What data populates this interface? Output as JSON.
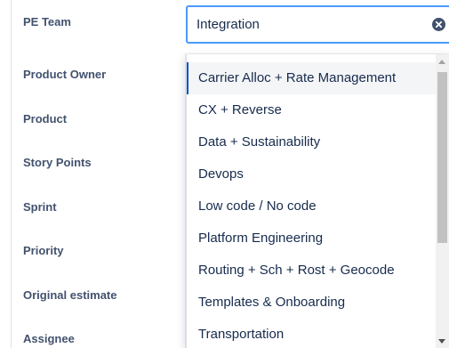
{
  "form": {
    "labels": [
      "PE Team",
      "Product Owner",
      "Product",
      "Story Points",
      "Sprint",
      "Priority",
      "Original estimate",
      "Assignee"
    ]
  },
  "pe_team_select": {
    "value": "Integration",
    "clear_icon": "clear-circle-x-icon",
    "options": [
      "Carrier Alloc + Rate Management",
      "CX + Reverse",
      "Data + Sustainability",
      "Devops",
      "Low code / No code",
      "Platform Engineering",
      "Routing + Sch + Rost + Geocode",
      "Templates & Onboarding",
      "Transportation"
    ],
    "highlighted_option": "Carrier Alloc + Rate Management"
  },
  "colors": {
    "focus_border": "#4c9aff",
    "highlight_bar": "#0052cc",
    "label_text": "#42526e",
    "option_text": "#172b4d"
  }
}
